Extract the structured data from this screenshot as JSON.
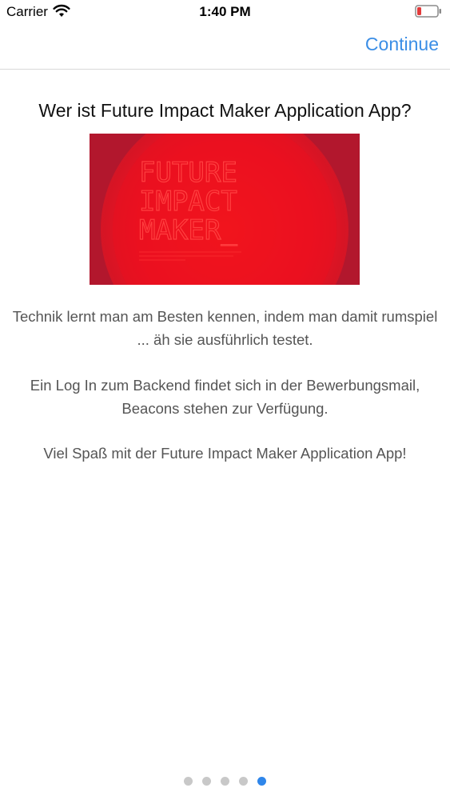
{
  "status_bar": {
    "carrier": "Carrier",
    "time": "1:40 PM",
    "battery_color": "#e23b3b"
  },
  "nav": {
    "continue_label": "Continue",
    "accent_color": "#3b8ee6"
  },
  "content": {
    "title": "Wer ist Future Impact Maker Application App?",
    "hero_image": {
      "logo_lines": [
        "FUTURE",
        "IMPACT",
        "MAKER_"
      ],
      "background_color": "#b2172d",
      "accent_color": "#ff2020"
    },
    "paragraphs": [
      "Technik lernt man am Besten kennen, indem man damit rumspiel ... äh sie ausführlich testet.",
      "Ein Log In zum Backend findet sich in der Bewerbungsmail, Beacons stehen zur Verfügung.",
      "Viel Spaß mit der Future Impact Maker Application App!"
    ]
  },
  "pager": {
    "total": 5,
    "current": 5,
    "active_color": "#2f86ea",
    "inactive_color": "#c8c8c8"
  }
}
